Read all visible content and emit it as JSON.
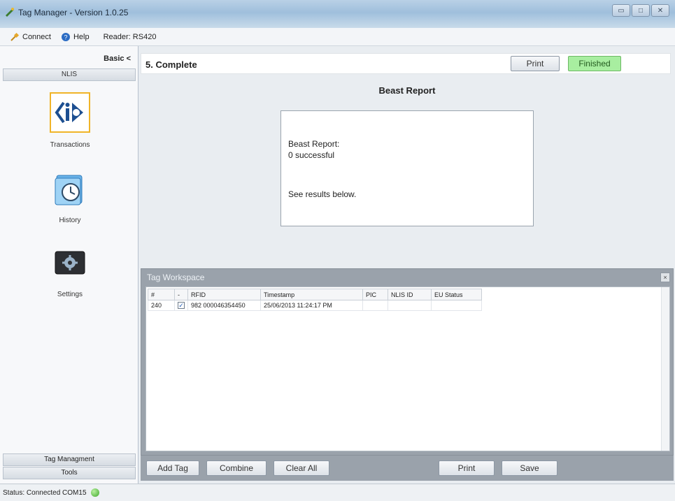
{
  "window": {
    "title": "Tag Manager - Version 1.0.25"
  },
  "menubar": {
    "connect_label": "Connect",
    "help_label": "Help",
    "reader_label": "Reader: RS420"
  },
  "sidebar": {
    "basic_toggle": "Basic <",
    "section_nlis": "NLIS",
    "items": [
      {
        "label": "Transactions",
        "icon": "id-logo-icon"
      },
      {
        "label": "History",
        "icon": "clock-folder-icon"
      },
      {
        "label": "Settings",
        "icon": "gear-icon"
      }
    ],
    "bottom_tag_management": "Tag Managment",
    "bottom_tools": "Tools"
  },
  "step": {
    "title": "5. Complete",
    "print_label": "Print",
    "finished_label": "Finished"
  },
  "report": {
    "heading": "Beast Report",
    "line1": "Beast Report:",
    "line2": "0 successful",
    "line3": "See results below."
  },
  "workspace": {
    "title": "Tag Workspace",
    "columns": [
      "#",
      "-",
      "RFID",
      "Timestamp",
      "PIC",
      "NLIS ID",
      "EU Status"
    ],
    "rows": [
      {
        "num": "240",
        "checked": true,
        "rfid": "982 000046354450",
        "timestamp": "25/06/2013 11:24:17 PM",
        "pic": "",
        "nlis_id": "",
        "eu_status": ""
      }
    ]
  },
  "actions": {
    "add_tag": "Add Tag",
    "combine": "Combine",
    "clear_all": "Clear All",
    "print": "Print",
    "save": "Save"
  },
  "status": {
    "text": "Status: Connected COM15"
  },
  "colors": {
    "finished_bg": "#a8eea0",
    "workspace_header": "#9aa2ab",
    "accent_blue": "#1d4f91"
  }
}
